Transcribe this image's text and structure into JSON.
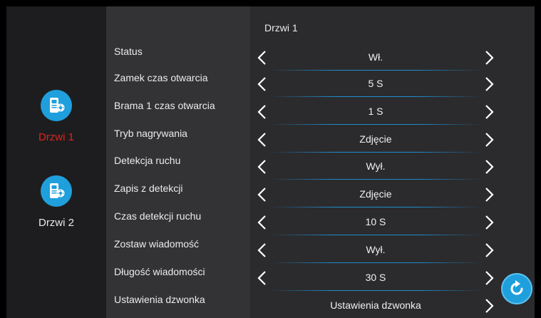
{
  "header": {
    "title": "Drzwi 1"
  },
  "sidebar": {
    "items": [
      {
        "label": "Drzwi 1",
        "icon": "door-station-settings-icon",
        "active": true
      },
      {
        "label": "Drzwi 2",
        "icon": "door-station-settings-icon",
        "active": false
      }
    ]
  },
  "settings": [
    {
      "label": "Status",
      "value": "Wł."
    },
    {
      "label": "Zamek czas otwarcia",
      "value": "5 S"
    },
    {
      "label": "Brama 1 czas otwarcia",
      "value": "1 S"
    },
    {
      "label": "Tryb nagrywania",
      "value": "Zdjęcie"
    },
    {
      "label": "Detekcja ruchu",
      "value": "Wył."
    },
    {
      "label": "Zapis z detekcji",
      "value": "Zdjęcie"
    },
    {
      "label": "Czas detekcji ruchu",
      "value": "10 S"
    },
    {
      "label": "Zostaw wiadomość",
      "value": "Wył."
    },
    {
      "label": "Długość wiadomości",
      "value": "30 S"
    },
    {
      "label": "Ustawienia dzwonka",
      "value": "Ustawienia dzwonka"
    }
  ],
  "colors": {
    "accent": "#1f9fdc",
    "active": "#e3221a",
    "sidebar": "#1d1d1f",
    "panel": "#2b2b2e"
  },
  "refresh": {
    "icon": "refresh-icon"
  }
}
